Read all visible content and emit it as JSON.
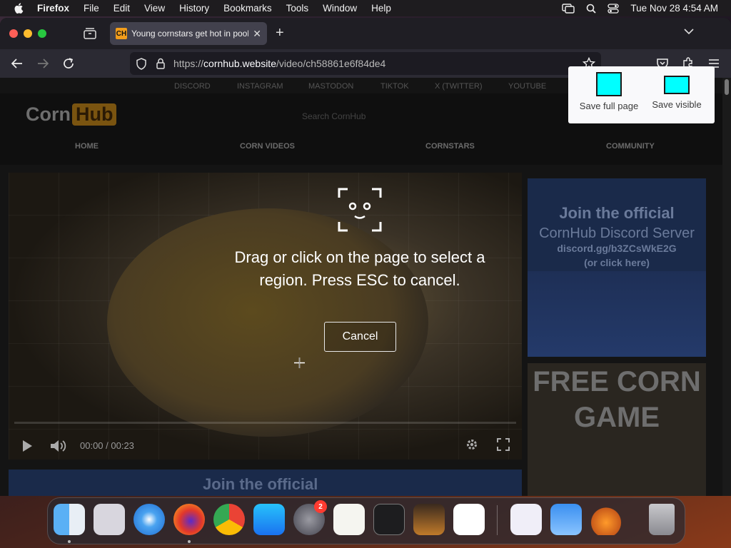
{
  "menubar": {
    "app_name": "Firefox",
    "menus": [
      "File",
      "Edit",
      "View",
      "History",
      "Bookmarks",
      "Tools",
      "Window",
      "Help"
    ],
    "clock": "Tue Nov 28  4:54 AM"
  },
  "browser": {
    "tab_title": "Young cornstars get hot in pool",
    "tab_favicon_text": "CH",
    "url_prefix": "https://",
    "url_domain": "cornhub.website",
    "url_path": "/video/ch58861e6f84de4"
  },
  "site": {
    "social_links": [
      "DISCORD",
      "INSTAGRAM",
      "MASTODON",
      "TIKTOK",
      "X (TWITTER)",
      "YOUTUBE"
    ],
    "logo_part1": "Corn",
    "logo_part2": "Hub",
    "search_placeholder": "Search CornHub",
    "nav": [
      "HOME",
      "CORN VIDEOS",
      "CORNSTARS",
      "COMMUNITY"
    ],
    "active_nav": "CORN VIDEOS",
    "video_time": "00:00 / 00:23",
    "ad_discord": {
      "line1": "Join the official",
      "line2": "CornHub Discord Server",
      "line3": "discord.gg/b3ZCsWkE2G",
      "line4": "(or click here)"
    },
    "ad_game": [
      "FREE CORN",
      "GAME"
    ],
    "banner_text": "Join the official"
  },
  "screenshot_tool": {
    "save_full_label": "Save full page",
    "save_visible_label": "Save visible",
    "instruction_line1": "Drag or click on the page to select a",
    "instruction_line2": "region. Press ESC to cancel.",
    "cancel_label": "Cancel"
  },
  "dock": {
    "apps": [
      "finder-icon",
      "launchpad-icon",
      "safari-icon",
      "firefox-icon",
      "chrome-icon",
      "app-store-icon",
      "system-settings-icon",
      "textedit-icon",
      "terminal-icon",
      "garageband-icon",
      "vscode-icon",
      "visual-studio-icon",
      "weather-icon",
      "disk-utility-icon",
      "trash-icon"
    ],
    "settings_badge": "2"
  },
  "colors": {
    "accent": "#f29d1b",
    "overlay_highlight": "#00ffff",
    "menubar": "#1e1c1f"
  }
}
